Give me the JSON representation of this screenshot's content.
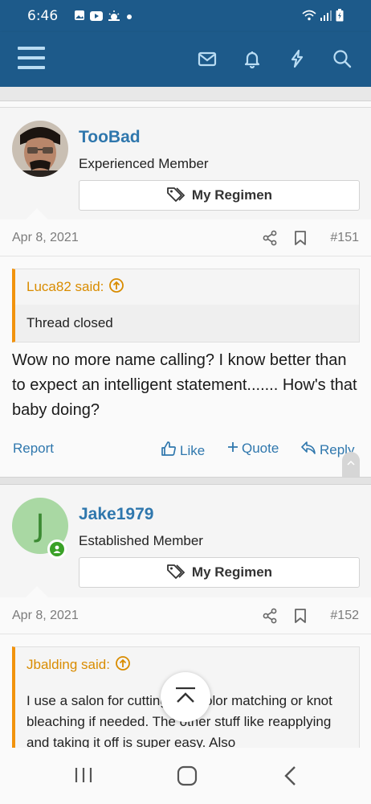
{
  "status_bar": {
    "time": "6:46"
  },
  "toolbar": {
    "icons": [
      "menu-icon",
      "envelope-icon",
      "bell-icon",
      "bolt-icon",
      "search-icon"
    ]
  },
  "posts": [
    {
      "username": "TooBad",
      "user_title": "Experienced Member",
      "regimen_label": "My Regimen",
      "date": "Apr 8, 2021",
      "post_number": "#151",
      "quote": {
        "author": "Luca82 said:",
        "text": "Thread closed"
      },
      "message": "Wow no more name calling? I know better than to expect an intelligent statement....... How's that baby doing?",
      "actions": {
        "report": "Report",
        "like": "Like",
        "quote": "Quote",
        "reply": "Reply"
      }
    },
    {
      "username": "Jake1979",
      "avatar_letter": "J",
      "user_title": "Established Member",
      "regimen_label": "My Regimen",
      "date": "Apr 8, 2021",
      "post_number": "#152",
      "quote": {
        "author": "Jbalding said:",
        "text": "I use a salon for cutting and color matching or knot bleaching if needed. The other stuff like reapplying and taking it off is super easy. Also"
      }
    }
  ],
  "colors": {
    "header": "#1d5a8a",
    "link": "#2f77ad",
    "quote_accent": "#f2930d",
    "online": "#3aa127"
  }
}
